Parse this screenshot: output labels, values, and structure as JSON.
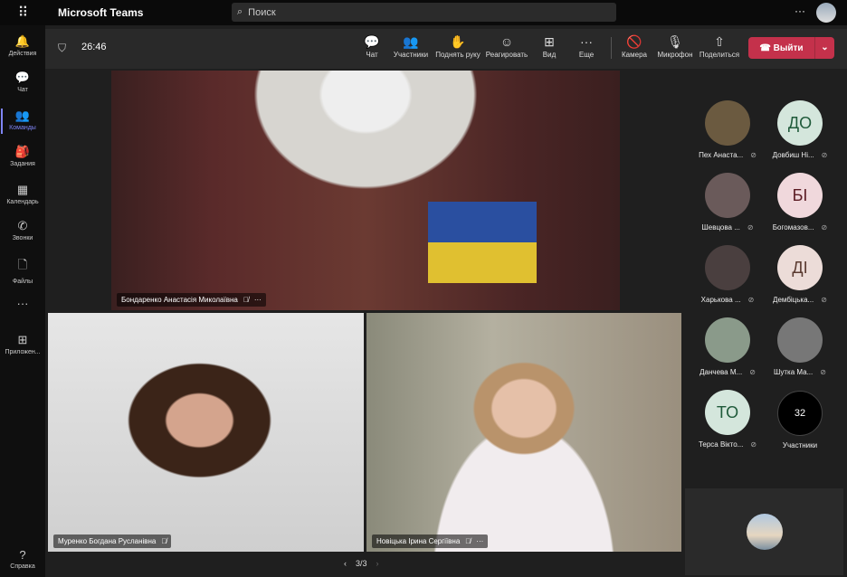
{
  "app": {
    "title": "Microsoft Teams",
    "search_placeholder": "Поиск",
    "more": "···"
  },
  "sidebar": {
    "items": [
      {
        "label": "Действия",
        "icon": "🔔"
      },
      {
        "label": "Чат",
        "icon": "💬"
      },
      {
        "label": "Команды",
        "icon": "👥"
      },
      {
        "label": "Задания",
        "icon": "🎒"
      },
      {
        "label": "Календарь",
        "icon": "▦"
      },
      {
        "label": "Звонки",
        "icon": "✆"
      },
      {
        "label": "Файлы",
        "icon": "🗋"
      },
      {
        "label": "",
        "icon": "···"
      },
      {
        "label": "Приложен...",
        "icon": "⊞"
      }
    ],
    "help": {
      "label": "Справка",
      "icon": "?"
    }
  },
  "meeting": {
    "timer": "26:46",
    "tools": [
      {
        "label": "Чат",
        "icon": "💬"
      },
      {
        "label": "Участники",
        "icon": "👥"
      },
      {
        "label": "Поднять руку",
        "icon": "✋"
      },
      {
        "label": "Реагировать",
        "icon": "☺"
      },
      {
        "label": "Вид",
        "icon": "⊞"
      },
      {
        "label": "Еще",
        "icon": "···"
      },
      {
        "label": "Камера",
        "icon": "🚫"
      },
      {
        "label": "Микрофон",
        "icon": "🎙"
      },
      {
        "label": "Поделиться",
        "icon": "⇧"
      }
    ],
    "leave": "Выйти"
  },
  "videos": [
    {
      "name": "Бондаренко Анастасія Миколаївна"
    },
    {
      "name": "Муренко Богдана Русланівна"
    },
    {
      "name": "Новіцька Ірина Сергіївна"
    }
  ],
  "participants": [
    {
      "name": "Пех Анаста...",
      "initials": "",
      "bg": "#6b5a40"
    },
    {
      "name": "Довбиш Ні...",
      "initials": "ДО",
      "bg": "#d4e6dc",
      "fg": "#1f5a3a"
    },
    {
      "name": "Шевцова ...",
      "initials": "",
      "bg": "#6a5a5a"
    },
    {
      "name": "Богомазов...",
      "initials": "БІ",
      "bg": "#f0d8dc",
      "fg": "#5a1a22"
    },
    {
      "name": "Харькова ...",
      "initials": "",
      "bg": "#4a3f3f"
    },
    {
      "name": "Дембіцька...",
      "initials": "ДІ",
      "bg": "#ecdcd8",
      "fg": "#5a3a30"
    },
    {
      "name": "Данчева М...",
      "initials": "",
      "bg": "#8a9a8a"
    },
    {
      "name": "Шутка Ма...",
      "initials": "",
      "bg": "#777"
    },
    {
      "name": "Терса Вікто...",
      "initials": "ТО",
      "bg": "#d4e6dc",
      "fg": "#1f5a3a"
    }
  ],
  "participants_count": {
    "count": "32",
    "label": "Участники"
  },
  "pager": {
    "text": "3/3",
    "prev": "‹",
    "next": "›"
  }
}
